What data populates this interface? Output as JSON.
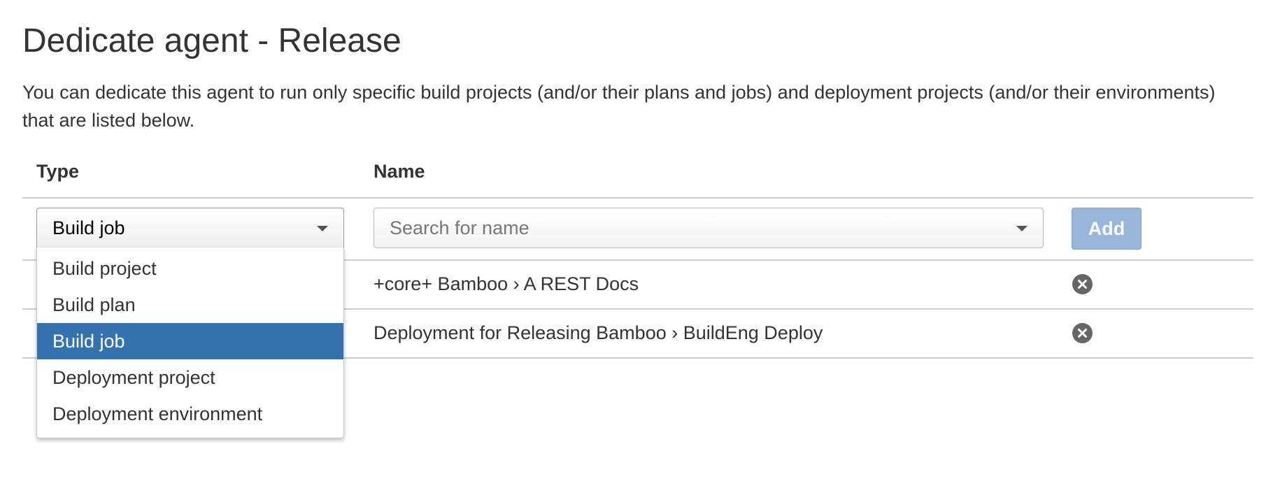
{
  "page": {
    "title": "Dedicate agent - Release",
    "description": "You can dedicate this agent to run only specific build projects (and/or their plans and jobs) and deployment projects (and/or their environments) that are listed below."
  },
  "table": {
    "headers": {
      "type": "Type",
      "name": "Name"
    },
    "type_select": {
      "selected": "Build job",
      "options": [
        "Build project",
        "Build plan",
        "Build job",
        "Deployment project",
        "Deployment environment"
      ],
      "expanded": true,
      "selected_index": 2
    },
    "name_search": {
      "placeholder": "Search for name",
      "value": ""
    },
    "add_label": "Add",
    "rows": [
      {
        "name": "+core+ Bamboo › A REST Docs",
        "remove_icon": "remove-circle-icon"
      },
      {
        "name": "Deployment for Releasing Bamboo › BuildEng Deploy",
        "remove_icon": "remove-circle-icon"
      }
    ]
  },
  "colors": {
    "selected_option_bg": "#3572b0",
    "add_button_bg": "#97b6d9",
    "text": "#333333",
    "divider": "#cccccc"
  }
}
